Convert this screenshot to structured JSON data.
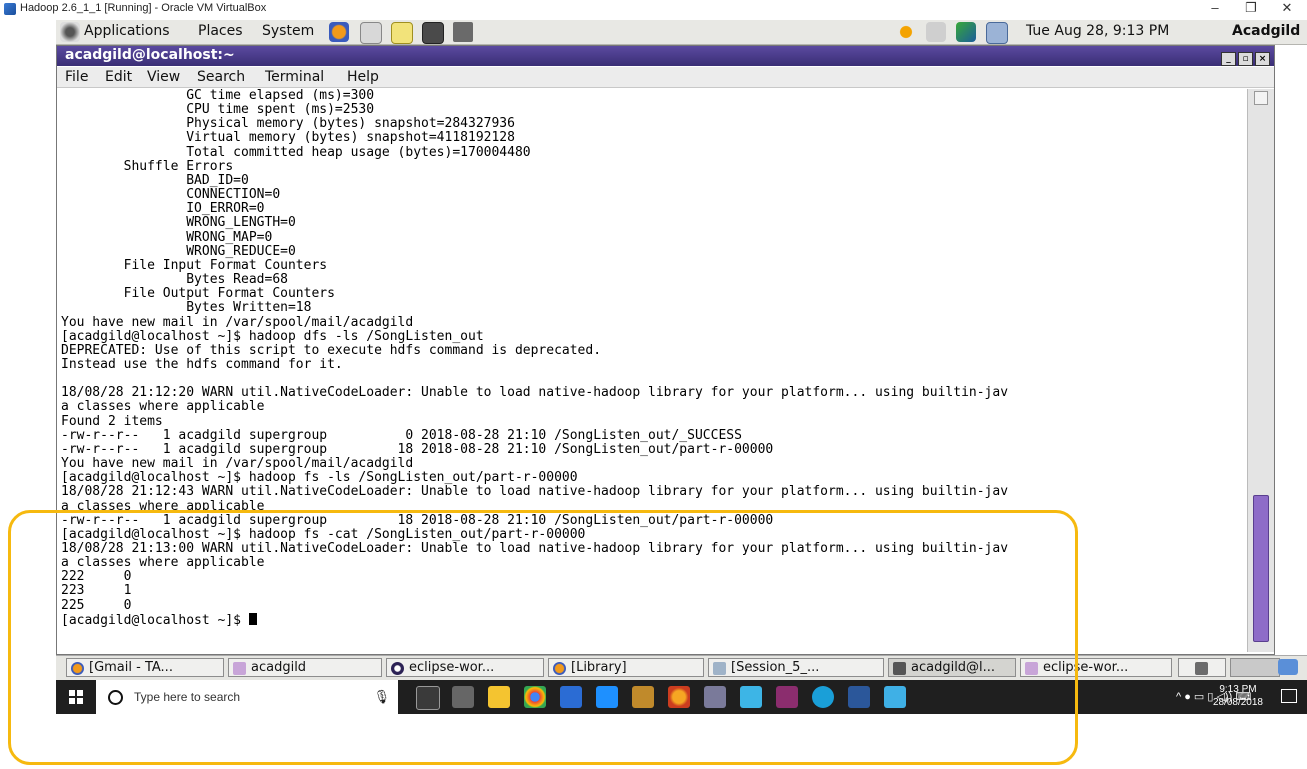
{
  "host_window": {
    "title": "Hadoop 2.6_1_1 [Running] - Oracle VM VirtualBox",
    "minimize": "–",
    "restore": "❐",
    "close": "✕"
  },
  "guest_panel": {
    "menus": [
      "Applications",
      "Places",
      "System"
    ],
    "datetime": "Tue Aug 28,  9:13 PM",
    "user": "Acadgild"
  },
  "terminal": {
    "title": "acadgild@localhost:~",
    "menus": [
      "File",
      "Edit",
      "View",
      "Search",
      "Terminal",
      "Help"
    ],
    "lines": [
      "                GC time elapsed (ms)=300",
      "                CPU time spent (ms)=2530",
      "                Physical memory (bytes) snapshot=284327936",
      "                Virtual memory (bytes) snapshot=4118192128",
      "                Total committed heap usage (bytes)=170004480",
      "        Shuffle Errors",
      "                BAD_ID=0",
      "                CONNECTION=0",
      "                IO_ERROR=0",
      "                WRONG_LENGTH=0",
      "                WRONG_MAP=0",
      "                WRONG_REDUCE=0",
      "        File Input Format Counters",
      "                Bytes Read=68",
      "        File Output Format Counters",
      "                Bytes Written=18",
      "You have new mail in /var/spool/mail/acadgild",
      "[acadgild@localhost ~]$ hadoop dfs -ls /SongListen_out",
      "DEPRECATED: Use of this script to execute hdfs command is deprecated.",
      "Instead use the hdfs command for it.",
      "",
      "18/08/28 21:12:20 WARN util.NativeCodeLoader: Unable to load native-hadoop library for your platform... using builtin-jav",
      "a classes where applicable",
      "Found 2 items",
      "-rw-r--r--   1 acadgild supergroup          0 2018-08-28 21:10 /SongListen_out/_SUCCESS",
      "-rw-r--r--   1 acadgild supergroup         18 2018-08-28 21:10 /SongListen_out/part-r-00000",
      "You have new mail in /var/spool/mail/acadgild",
      "[acadgild@localhost ~]$ hadoop fs -ls /SongListen_out/part-r-00000",
      "18/08/28 21:12:43 WARN util.NativeCodeLoader: Unable to load native-hadoop library for your platform... using builtin-jav",
      "a classes where applicable",
      "-rw-r--r--   1 acadgild supergroup         18 2018-08-28 21:10 /SongListen_out/part-r-00000",
      "[acadgild@localhost ~]$ hadoop fs -cat /SongListen_out/part-r-00000",
      "18/08/28 21:13:00 WARN util.NativeCodeLoader: Unable to load native-hadoop library for your platform... using builtin-jav",
      "a classes where applicable",
      "222     0",
      "223     1",
      "225     0"
    ],
    "prompt": "[acadgild@localhost ~]$ "
  },
  "guest_taskbar": {
    "items": [
      "[Gmail - TA...",
      "acadgild",
      "eclipse-wor...",
      "[Library]",
      "[Session_5_...",
      "acadgild@l...",
      "eclipse-wor..."
    ]
  },
  "windows_taskbar": {
    "search_placeholder": "Type here to search",
    "time": "9:13 PM",
    "date": "28/08/2018"
  }
}
